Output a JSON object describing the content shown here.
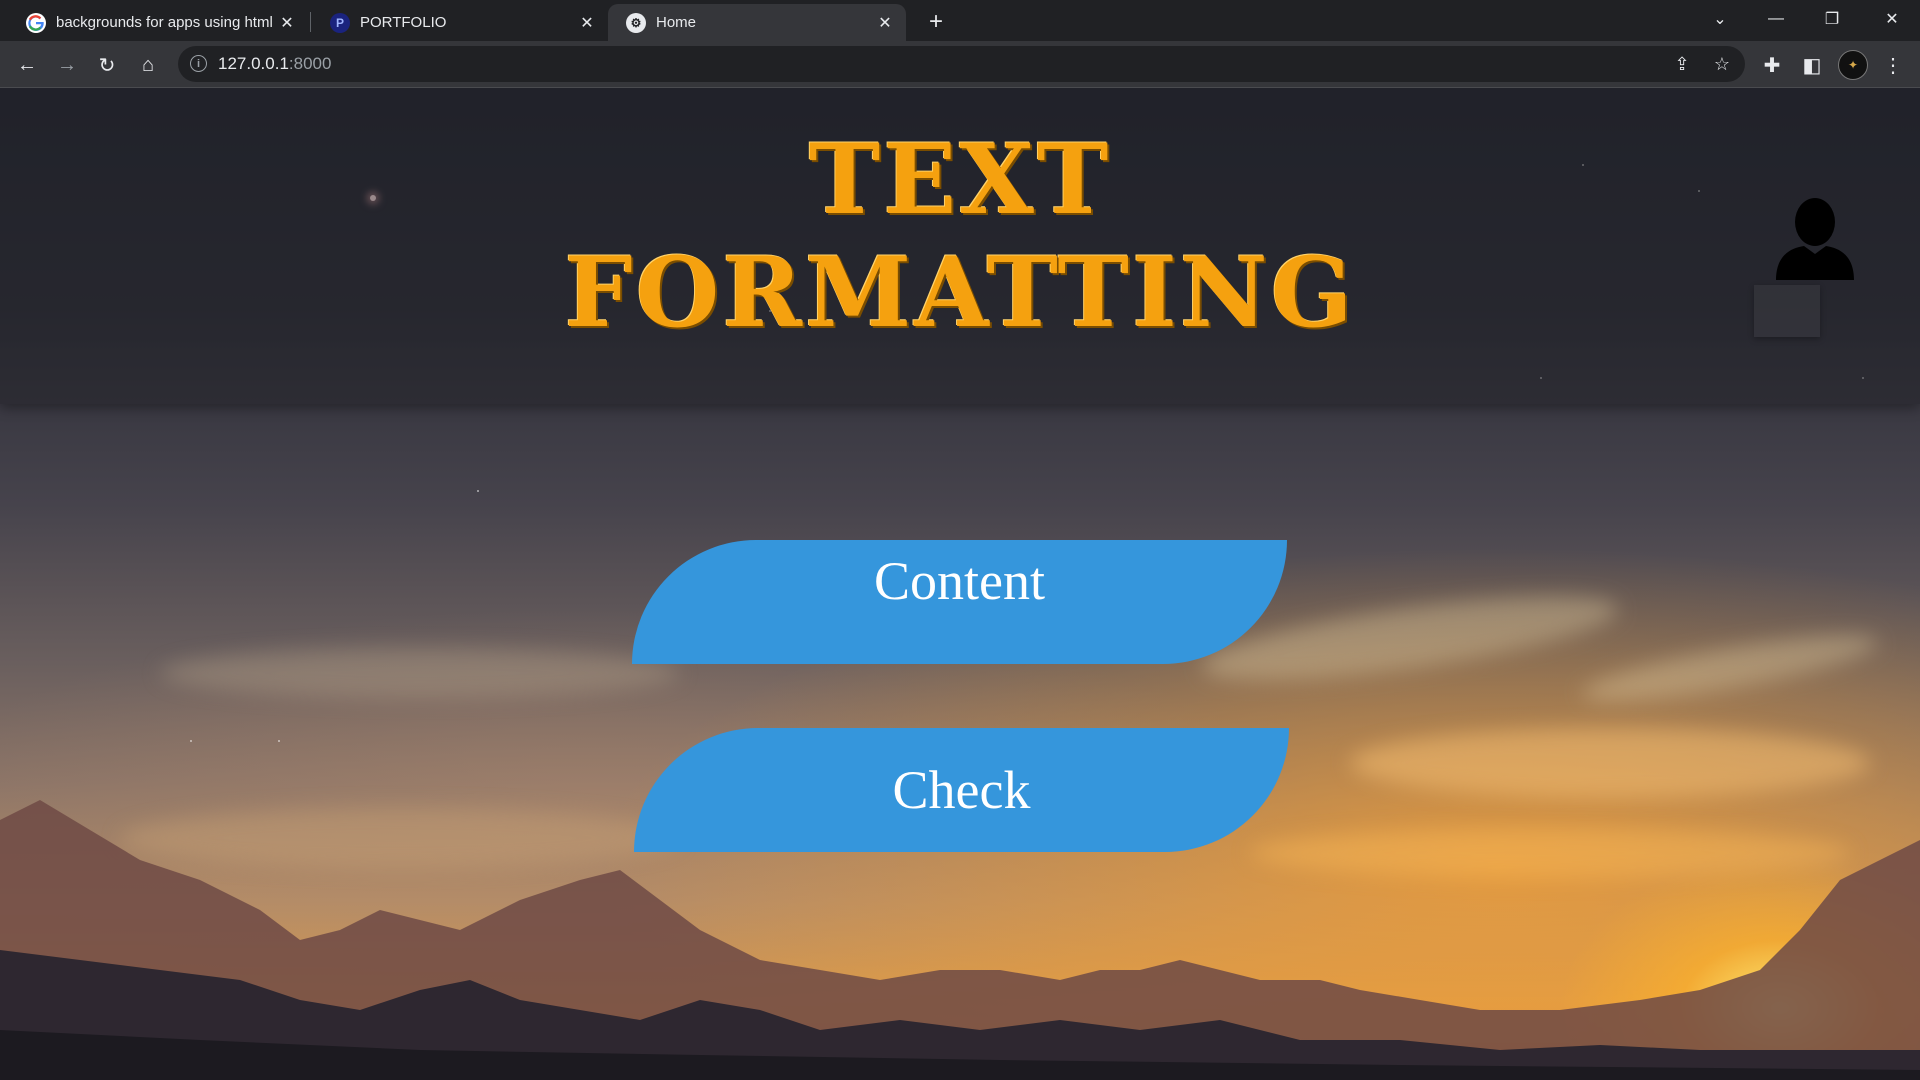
{
  "browser": {
    "tabs": [
      {
        "title": "backgrounds for apps using html",
        "favicon": "google-icon"
      },
      {
        "title": "PORTFOLIO",
        "favicon": "portfolio-icon"
      },
      {
        "title": "Home",
        "favicon": "site-icon",
        "active": true
      }
    ],
    "new_tab": "+",
    "address": {
      "host": "127.0.0.1",
      "port": ":8000"
    }
  },
  "page": {
    "title": "TEXT FORMATTING",
    "buttons": [
      {
        "label": "Content"
      },
      {
        "label": "Check"
      }
    ],
    "colors": {
      "title": "#f5a10f",
      "button": "#3596dc",
      "button_text": "#ffffff"
    }
  }
}
